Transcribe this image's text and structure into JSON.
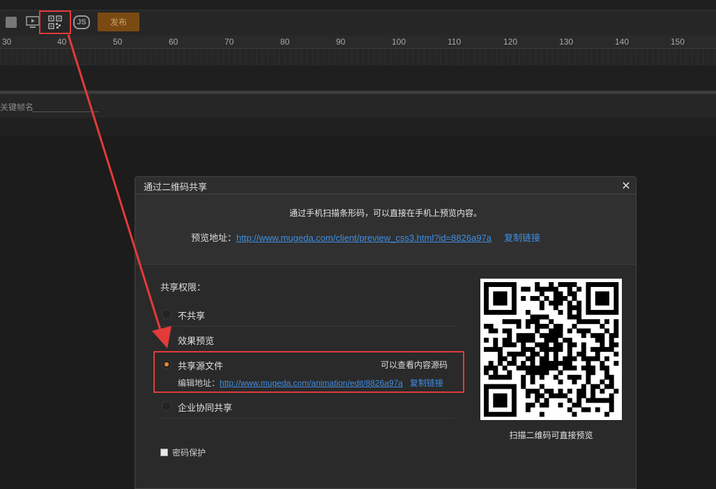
{
  "toolbar": {
    "publish_label": "发布",
    "js_label": "JS",
    "icons": [
      "stop-icon",
      "preview-screen-icon",
      "qrcode-icon",
      "js-icon"
    ]
  },
  "ruler": {
    "ticks": [
      "30",
      "40",
      "50",
      "60",
      "70",
      "80",
      "90",
      "100",
      "110",
      "120",
      "130",
      "140",
      "150"
    ]
  },
  "keyframe": {
    "label": "关键帧名"
  },
  "dialog": {
    "title": "通过二维码共享",
    "close": "✕",
    "description": "通过手机扫描条形码，可以直接在手机上预览内容。",
    "preview_label": "预览地址：",
    "preview_url": "http://www.mugeda.com/client/preview_css3.html?id=8826a97a",
    "preview_copy": "复制链接",
    "permission_title": "共享权限：",
    "options": [
      {
        "label": "不共享",
        "selected": false
      },
      {
        "label": "效果预览",
        "selected": false
      },
      {
        "label": "共享源文件",
        "selected": true,
        "note": "可以查看内容源码"
      },
      {
        "label": "企业协同共享",
        "selected": false
      }
    ],
    "edit_label": "编辑地址：",
    "edit_url": "http://www.mugeda.com/animation/edit/8826a97a",
    "edit_copy": "复制链接",
    "password_label": "密码保护",
    "qr_caption": "扫描二维码可直接预览"
  },
  "colors": {
    "accent": "#f0862a",
    "link": "#3f8fe4",
    "highlight": "#e43a3a",
    "publish_bg": "#7a4a12"
  }
}
